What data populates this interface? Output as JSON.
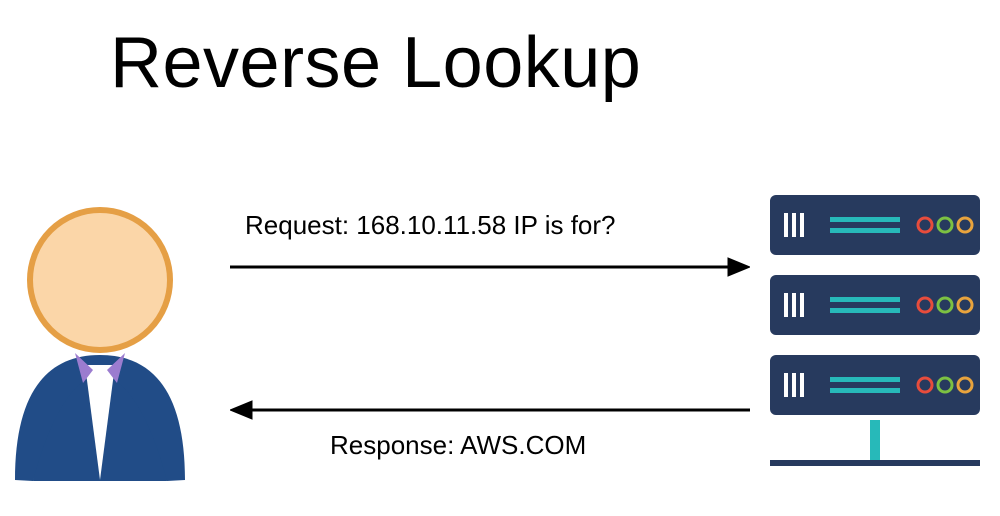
{
  "title": "Reverse Lookup",
  "request_label": "Request: 168.10.11.58 IP is for?",
  "response_label": "Response: AWS.COM",
  "icons": {
    "person": "person-icon",
    "server_stack": "server-stack-icon"
  },
  "colors": {
    "skin": "#FBD6A8",
    "skin_stroke": "#E59F45",
    "suit": "#214C87",
    "collar": "#9B7CCF",
    "server": "#273A5E",
    "led_teal": "#27B9B9",
    "led_red": "#E74C3C",
    "led_green": "#7CC142",
    "led_orange": "#E8A33D"
  }
}
